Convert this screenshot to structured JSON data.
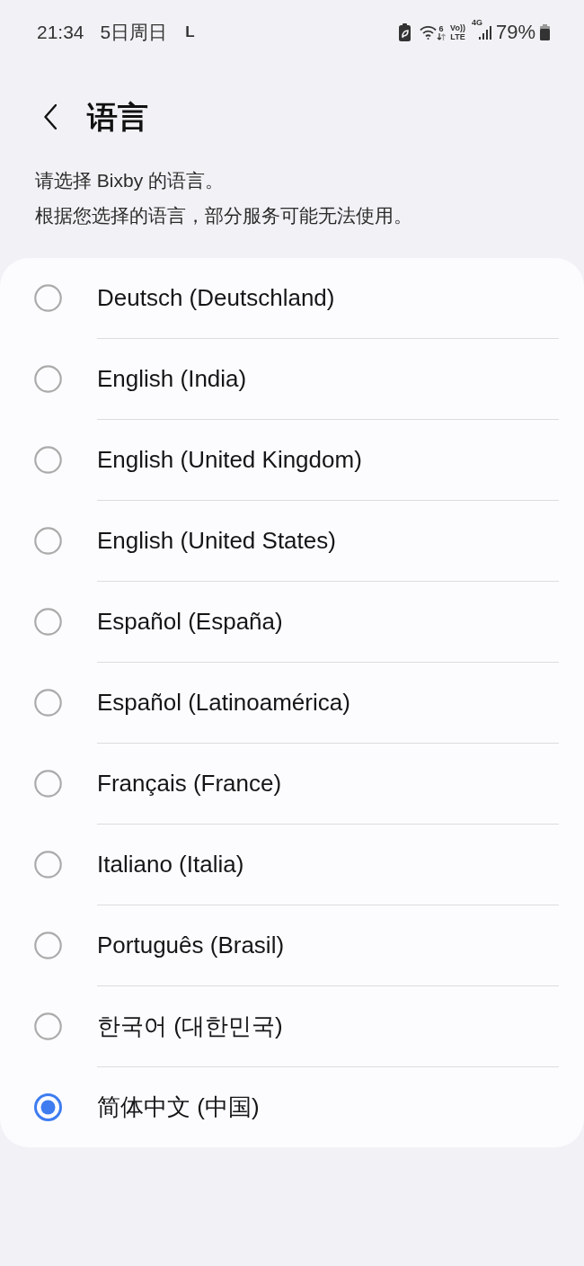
{
  "status_bar": {
    "time": "21:34",
    "date": "5日周日",
    "notification": "L",
    "wifi_standard": "6",
    "volte_top": "Vo))",
    "volte_bottom": "LTE",
    "network_type": "4G",
    "battery_percent": "79%"
  },
  "header": {
    "title": "语言"
  },
  "description": [
    "请选择 Bixby 的语言。",
    "根据您选择的语言，部分服务可能无法使用。"
  ],
  "languages": [
    {
      "label": "Deutsch (Deutschland)",
      "selected": false
    },
    {
      "label": "English (India)",
      "selected": false
    },
    {
      "label": "English (United Kingdom)",
      "selected": false
    },
    {
      "label": "English (United States)",
      "selected": false
    },
    {
      "label": "Español (España)",
      "selected": false
    },
    {
      "label": "Español (Latinoamérica)",
      "selected": false
    },
    {
      "label": "Français (France)",
      "selected": false
    },
    {
      "label": "Italiano (Italia)",
      "selected": false
    },
    {
      "label": "Português (Brasil)",
      "selected": false
    },
    {
      "label": "한국어 (대한민국)",
      "selected": false
    },
    {
      "label": "简体中文 (中国)",
      "selected": true
    }
  ]
}
